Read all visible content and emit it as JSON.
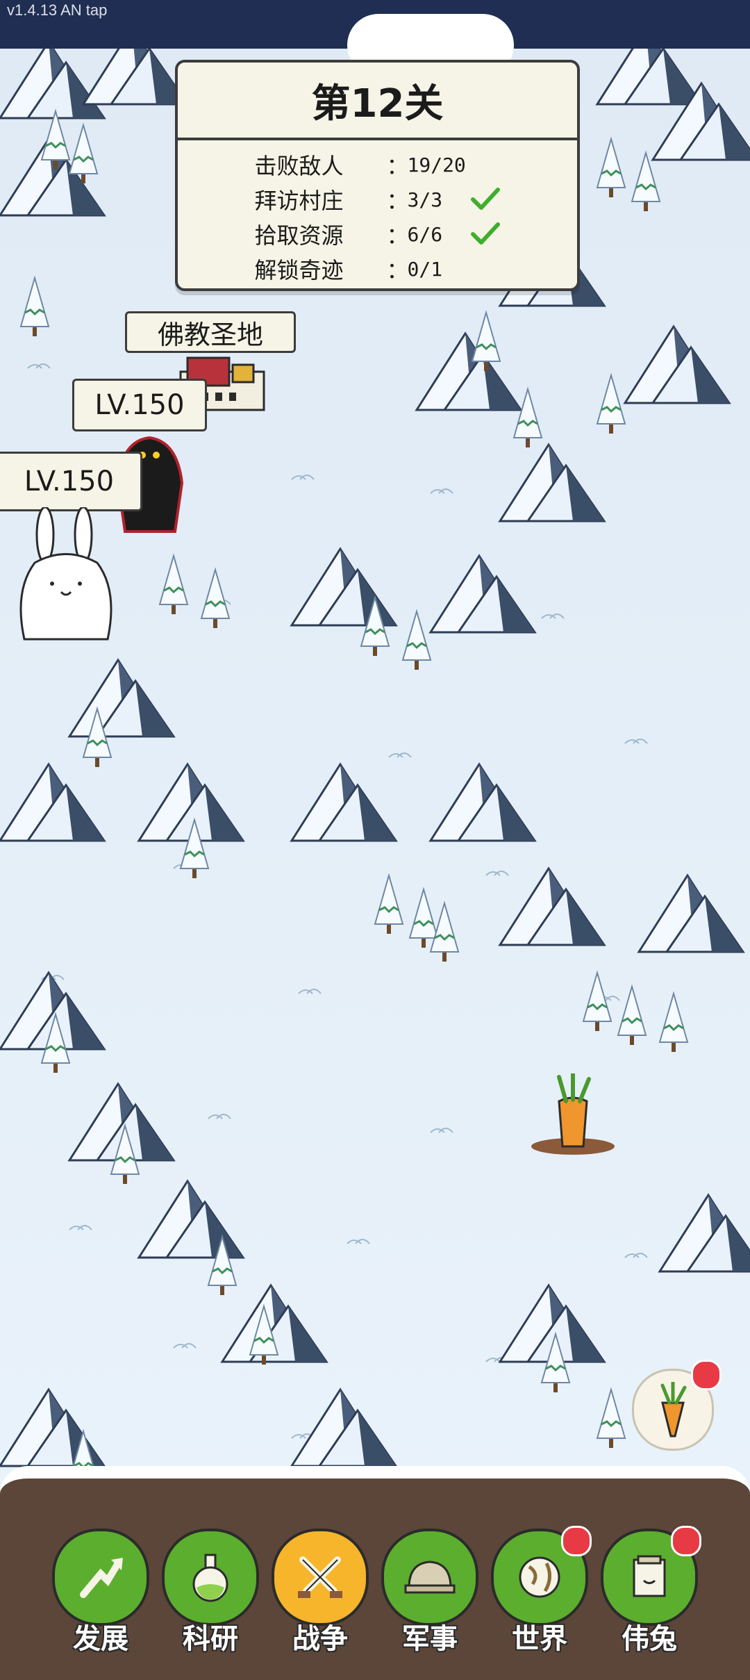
{
  "status_bar": {
    "version": "v1.4.13 AN tap"
  },
  "level_panel": {
    "title": "第12关",
    "objectives": [
      {
        "label": "击败敌人",
        "value": "19/20",
        "done": false
      },
      {
        "label": "拜访村庄",
        "value": "3/3",
        "done": true
      },
      {
        "label": "拾取资源",
        "value": "6/6",
        "done": true
      },
      {
        "label": "解锁奇迹",
        "value": "0/1",
        "done": false
      }
    ],
    "separator": "："
  },
  "map": {
    "landmark_label": "佛教圣地",
    "enemy_level": "LV.150",
    "player_level": "LV.150"
  },
  "carrot_button": {
    "icon": "carrot-icon",
    "has_notification": true
  },
  "nav": {
    "items": [
      {
        "label": "发展",
        "icon": "development-icon",
        "active": false,
        "badge": false
      },
      {
        "label": "科研",
        "icon": "flask-icon",
        "active": false,
        "badge": false
      },
      {
        "label": "战争",
        "icon": "crossed-swords-icon",
        "active": true,
        "badge": false
      },
      {
        "label": "军事",
        "icon": "helmet-icon",
        "active": false,
        "badge": false
      },
      {
        "label": "世界",
        "icon": "globe-icon",
        "active": false,
        "badge": true
      },
      {
        "label": "伟兔",
        "icon": "book-icon",
        "active": false,
        "badge": true
      }
    ]
  },
  "colors": {
    "snow": "#e8f2fa",
    "mountain_dark": "#3b4e68",
    "nav_green": "#5cae2e",
    "nav_active": "#f6b52b",
    "bar_brown": "#5b4639",
    "badge_red": "#e83a44"
  }
}
